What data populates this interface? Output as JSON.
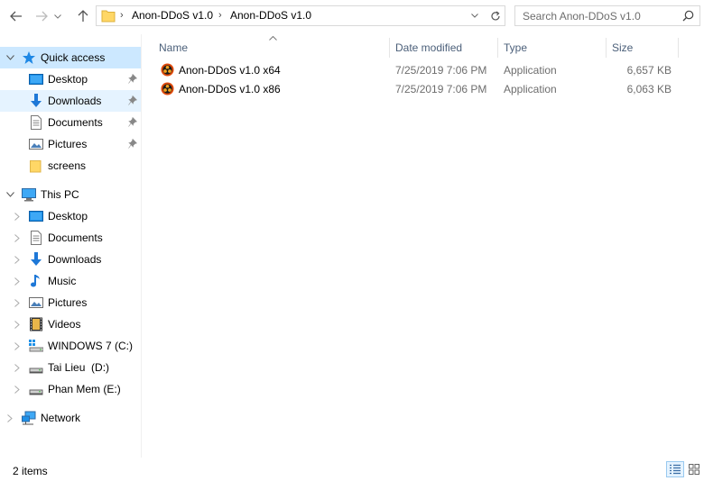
{
  "toolbar": {
    "breadcrumbs": [
      "Anon-DDoS v1.0",
      "Anon-DDoS v1.0"
    ],
    "search_placeholder": "Search Anon-DDoS v1.0"
  },
  "sidebar": {
    "quick_access": {
      "label": "Quick access",
      "items": [
        {
          "label": "Desktop",
          "icon": "desktop-icon",
          "pinned": true
        },
        {
          "label": "Downloads",
          "icon": "download-arrow-icon",
          "pinned": true
        },
        {
          "label": "Documents",
          "icon": "documents-icon",
          "pinned": true
        },
        {
          "label": "Pictures",
          "icon": "pictures-icon",
          "pinned": true
        },
        {
          "label": "screens",
          "icon": "folder-icon",
          "pinned": false
        }
      ]
    },
    "this_pc": {
      "label": "This PC",
      "items": [
        {
          "label": "Desktop",
          "icon": "desktop-icon"
        },
        {
          "label": "Documents",
          "icon": "documents-icon"
        },
        {
          "label": "Downloads",
          "icon": "download-arrow-icon"
        },
        {
          "label": "Music",
          "icon": "music-note-icon"
        },
        {
          "label": "Pictures",
          "icon": "pictures-icon"
        },
        {
          "label": "Videos",
          "icon": "film-icon"
        },
        {
          "label": "WINDOWS 7 (C:)",
          "icon": "system-drive-icon"
        },
        {
          "label": "Tai Lieu  (D:)",
          "icon": "drive-icon"
        },
        {
          "label": "Phan Mem (E:)",
          "icon": "drive-icon"
        }
      ]
    },
    "network": {
      "label": "Network",
      "icon": "network-icon"
    }
  },
  "columns": {
    "name": "Name",
    "date": "Date modified",
    "type": "Type",
    "size": "Size"
  },
  "files": [
    {
      "name": "Anon-DDoS v1.0 x64",
      "date": "7/25/2019 7:06 PM",
      "type": "Application",
      "size": "6,657 KB",
      "icon": "biohazard-icon"
    },
    {
      "name": "Anon-DDoS v1.0 x86",
      "date": "7/25/2019 7:06 PM",
      "type": "Application",
      "size": "6,063 KB",
      "icon": "biohazard-icon"
    }
  ],
  "status": {
    "item_count": "2 items"
  },
  "colors": {
    "selected_bg": "#cce8ff",
    "accent": "#0078d7",
    "folder": "#ffd766",
    "column_header_text": "#4c607a"
  }
}
